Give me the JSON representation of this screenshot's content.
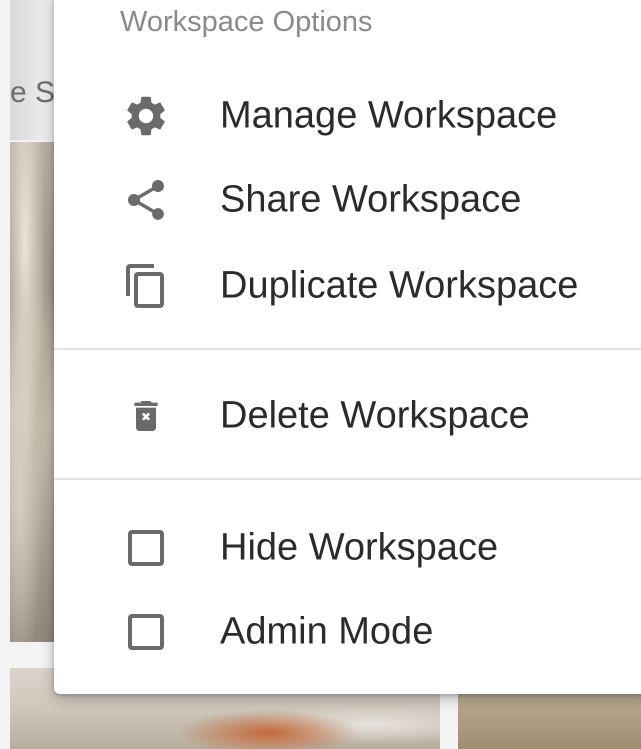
{
  "background": {
    "title_fragment": "e S"
  },
  "menu": {
    "header": "Workspace Options",
    "items": [
      {
        "label": "Manage Workspace",
        "icon": "gear-icon"
      },
      {
        "label": "Share Workspace",
        "icon": "share-icon"
      },
      {
        "label": "Duplicate Workspace",
        "icon": "duplicate-icon"
      },
      {
        "label": "Delete Workspace",
        "icon": "trash-icon"
      },
      {
        "label": "Hide Workspace",
        "icon": "checkbox-unchecked-icon",
        "checked": false
      },
      {
        "label": "Admin Mode",
        "icon": "checkbox-unchecked-icon",
        "checked": false
      }
    ]
  },
  "colors": {
    "icon": "#6a6a6a",
    "text": "#2b2b2b",
    "header": "#8a8a8a",
    "divider": "#e3e3e3"
  }
}
